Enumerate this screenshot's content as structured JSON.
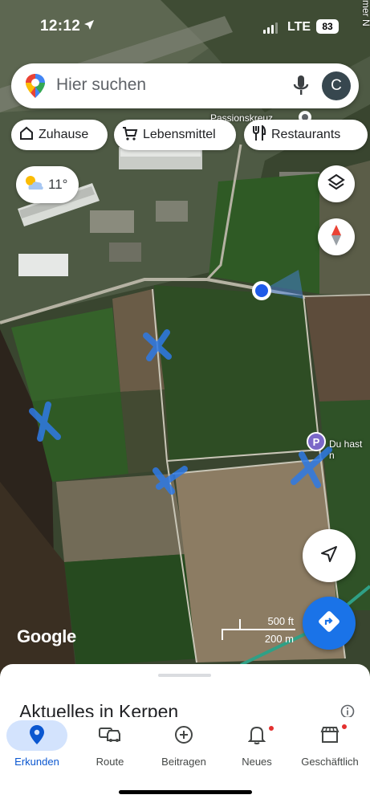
{
  "status_bar": {
    "time": "12:12",
    "network": "LTE",
    "battery": "83"
  },
  "search": {
    "placeholder": "Hier suchen",
    "avatar_letter": "C"
  },
  "chips": [
    {
      "label": "Zuhause",
      "icon": "home-icon"
    },
    {
      "label": "Lebensmittel",
      "icon": "cart-icon"
    },
    {
      "label": "Restaurants",
      "icon": "restaurant-icon"
    }
  ],
  "weather": {
    "temperature": "11°",
    "icon": "partly-cloudy-icon"
  },
  "map": {
    "poi_label": "Passionskreuz",
    "edge_label_top": "mer N",
    "parking_label": "Du hast n",
    "attribution": "Google",
    "scale_imperial": "500 ft",
    "scale_metric": "200 m",
    "marker_color": "#1e5be8",
    "accent_color": "#1a73e8"
  },
  "sheet": {
    "title": "Aktuelles in Kerpen"
  },
  "nav": [
    {
      "label": "Erkunden",
      "icon": "explore-pin-icon",
      "active": true
    },
    {
      "label": "Route",
      "icon": "car-icon",
      "active": false
    },
    {
      "label": "Beitragen",
      "icon": "add-circle-icon",
      "active": false
    },
    {
      "label": "Neues",
      "icon": "bell-icon",
      "active": false,
      "badge": true
    },
    {
      "label": "Geschäftlich",
      "icon": "store-icon",
      "active": false,
      "badge": true
    }
  ]
}
